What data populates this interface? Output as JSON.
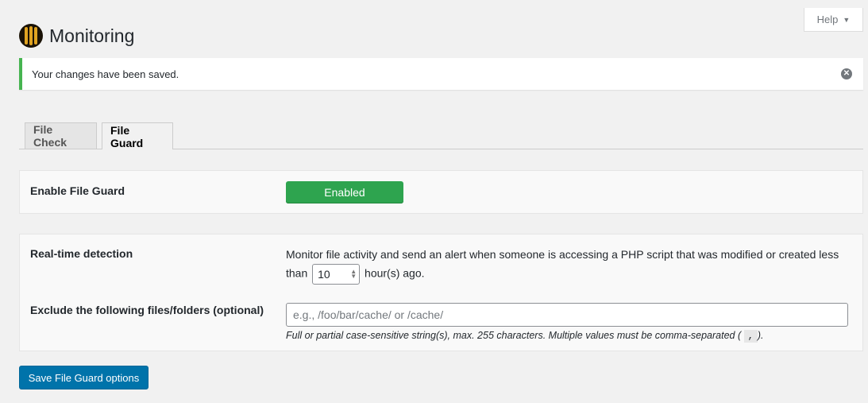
{
  "header": {
    "help_label": "Help",
    "help_caret": "▼",
    "title": "Monitoring"
  },
  "notice": {
    "message": "Your changes have been saved.",
    "dismiss_icon": "✕"
  },
  "tabs": [
    {
      "label": "File Check",
      "active": false
    },
    {
      "label": "File Guard",
      "active": true
    }
  ],
  "enable": {
    "label": "Enable File Guard",
    "button_label": "Enabled"
  },
  "realtime": {
    "label": "Real-time detection",
    "desc_before": "Monitor file activity and send an alert when someone is accessing a PHP script that was modified or created less than",
    "hours_value": "10",
    "desc_after": "hour(s) ago."
  },
  "exclude": {
    "label": "Exclude the following files/folders (optional)",
    "placeholder": "e.g., /foo/bar/cache/ or /cache/",
    "hint_before": "Full or partial case-sensitive string(s), max. 255 characters. Multiple values must be comma-separated (",
    "hint_code": ",",
    "hint_after": ")."
  },
  "save_label": "Save File Guard options",
  "colors": {
    "notice_border": "#46b450",
    "enabled_button": "#2ea44f",
    "primary_button": "#0073aa"
  }
}
